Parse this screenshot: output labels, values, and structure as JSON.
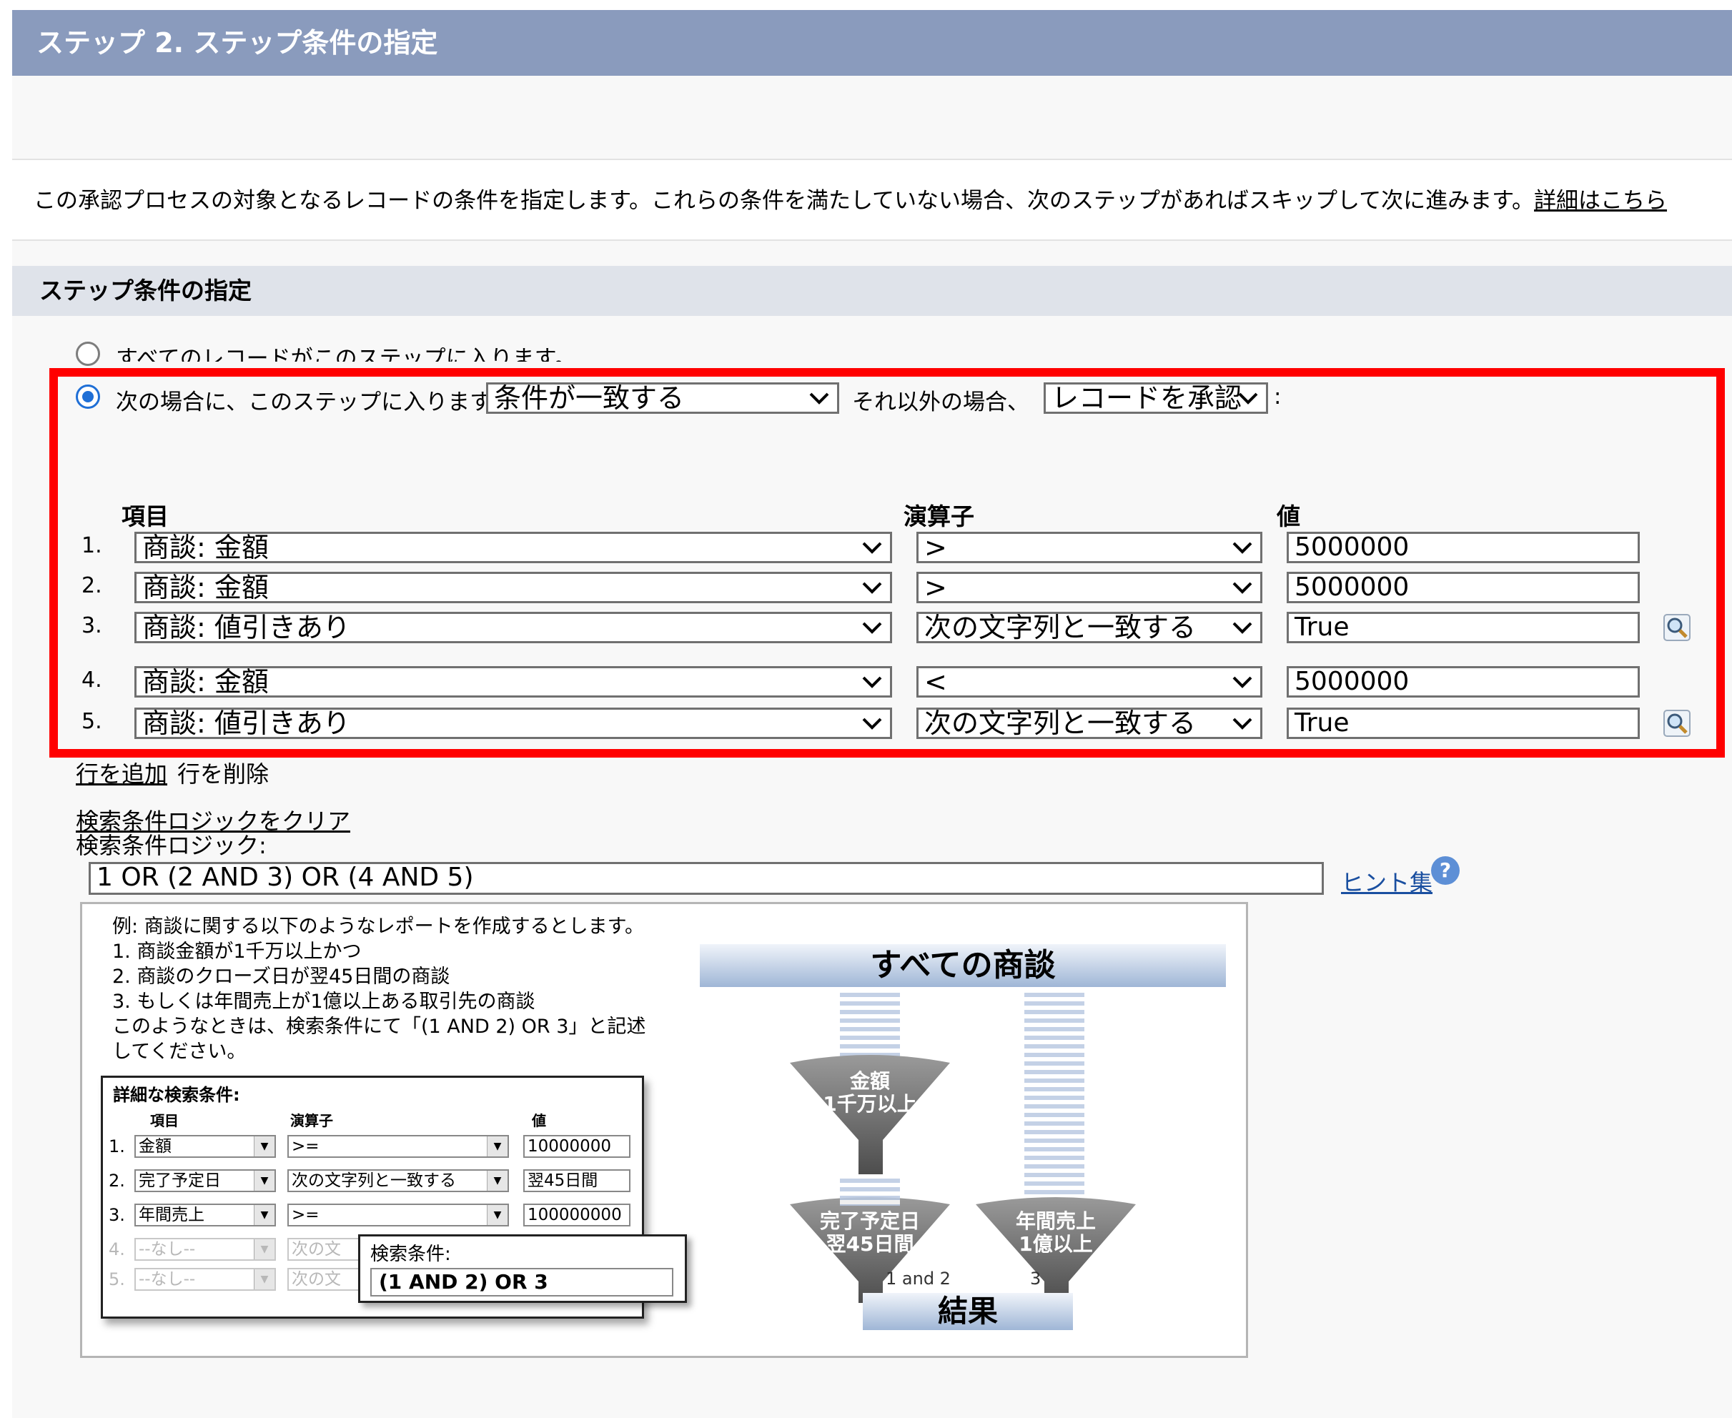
{
  "header": {
    "title": "ステップ 2. ステップ条件の指定"
  },
  "description": {
    "text": "この承認プロセスの対象となるレコードの条件を指定します。これらの条件を満たしていない場合、次のステップがあればスキップして次に進みます。",
    "link": "詳細はこちら"
  },
  "section": {
    "title": "ステップ条件の指定"
  },
  "radios": [
    {
      "label": "すべてのレコードがこのステップに入ります。",
      "selected": false
    },
    {
      "label": "次の場合に、このステップに入ります。",
      "selected": true
    }
  ],
  "criteria_select": "条件が一致する",
  "else_label": "それ以外の場合、",
  "else_select": "レコードを承認",
  "colon": ":",
  "columns": {
    "field": "項目",
    "operator": "演算子",
    "value": "値"
  },
  "rows": [
    {
      "num": "1.",
      "field": "商談: 金額",
      "operator": ">",
      "value": "5000000",
      "lookup": false
    },
    {
      "num": "2.",
      "field": "商談: 金額",
      "operator": ">",
      "value": "5000000",
      "lookup": false
    },
    {
      "num": "3.",
      "field": "商談: 値引きあり",
      "operator": "次の文字列と一致する",
      "value": "True",
      "lookup": true
    },
    {
      "num": "4.",
      "field": "商談: 金額",
      "operator": "<",
      "value": "5000000",
      "lookup": false
    },
    {
      "num": "5.",
      "field": "商談: 値引きあり",
      "operator": "次の文字列と一致する",
      "value": "True",
      "lookup": true
    }
  ],
  "row_actions": {
    "add": "行を追加",
    "delete": "行を削除"
  },
  "logic": {
    "clear": "検索条件ロジックをクリア",
    "label": "検索条件ロジック:",
    "value": "1 OR (2 AND 3) OR (4 AND 5)",
    "hints": "ヒント集",
    "help": "?"
  },
  "example": {
    "lines": [
      "例:  商談に関する以下のようなレポートを作成するとします。",
      "1. 商談金額が1千万以上かつ",
      "2. 商談のクローズ日が翌45日間の商談",
      "3. もしくは年間売上が1億以上ある取引先の商談",
      "このようなときは、検索条件にて「(1 AND 2) OR 3」と記述",
      "してください。"
    ],
    "table_title": "詳細な検索条件:",
    "headers": {
      "field": "項目",
      "operator": "演算子",
      "value": "値"
    },
    "rows": [
      {
        "num": "1.",
        "field": "金額",
        "operator": ">=",
        "value": "10000000",
        "dim": false
      },
      {
        "num": "2.",
        "field": "完了予定日",
        "operator": "次の文字列と一致する",
        "value": "翌45日間",
        "dim": false
      },
      {
        "num": "3.",
        "field": "年間売上",
        "operator": ">=",
        "value": "100000000",
        "dim": false
      },
      {
        "num": "4.",
        "field": "--なし--",
        "operator": "次の文",
        "value": "",
        "dim": true
      },
      {
        "num": "5.",
        "field": "--なし--",
        "operator": "次の文",
        "value": "",
        "dim": true
      }
    ],
    "popup_title": "検索条件:",
    "popup_value": "(1 AND 2) OR 3",
    "banner_top": "すべての商談",
    "funnel1": [
      "金額",
      "1千万以上"
    ],
    "funnel2": [
      "完了予定日",
      "翌45日間"
    ],
    "funnel3": [
      "年間売上",
      "1億以上"
    ],
    "label_and": "1 and 2",
    "label_3": "3",
    "banner_bottom": "結果"
  },
  "colors": {
    "header": "#8a9bbd",
    "highlight": "#ff0000",
    "radio_on": "#1f6fd6",
    "link": "#1a4fa0"
  }
}
